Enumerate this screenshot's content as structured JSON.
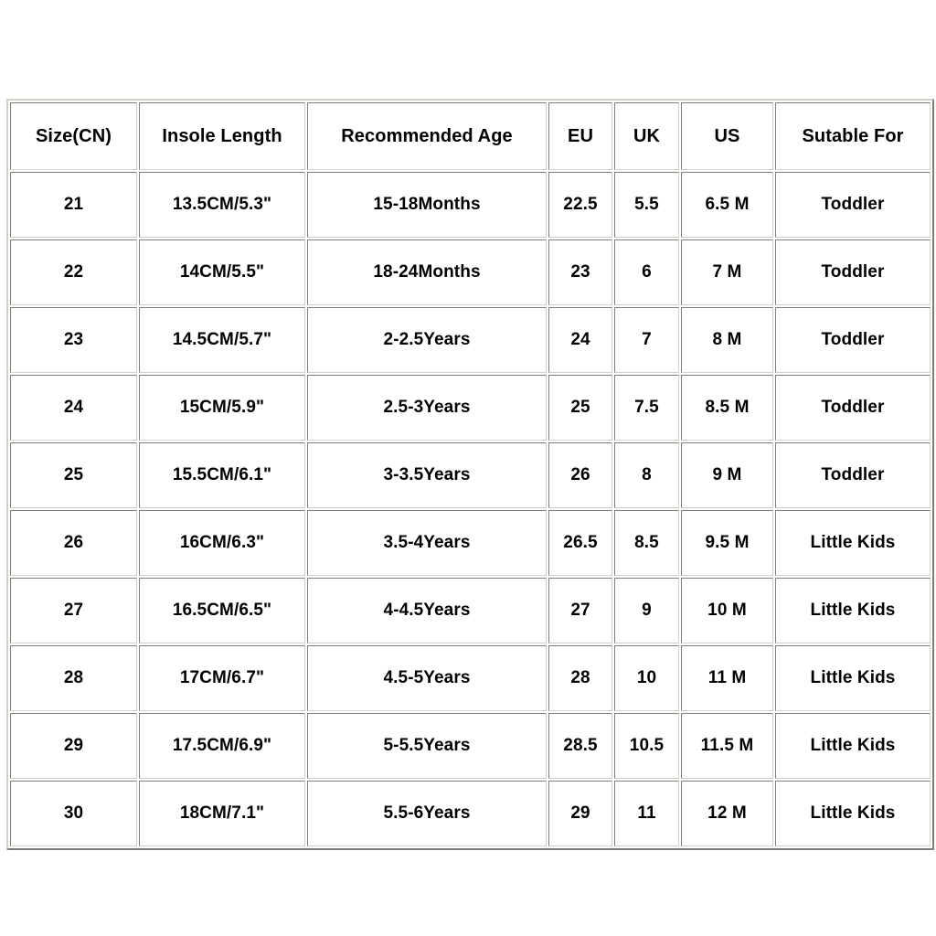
{
  "table": {
    "name": "shoe-size-chart",
    "columns": [
      {
        "key": "size_cn",
        "label": "Size(CN)"
      },
      {
        "key": "insole_length",
        "label": "Insole Length"
      },
      {
        "key": "recommended_age",
        "label": "Recommended Age"
      },
      {
        "key": "eu",
        "label": "EU"
      },
      {
        "key": "uk",
        "label": "UK"
      },
      {
        "key": "us",
        "label": "US"
      },
      {
        "key": "suitable_for",
        "label": "Sutable For"
      }
    ],
    "rows": [
      {
        "size_cn": "21",
        "insole_length": "13.5CM/5.3\"",
        "recommended_age": "15-18Months",
        "eu": "22.5",
        "uk": "5.5",
        "us": "6.5 M",
        "suitable_for": "Toddler"
      },
      {
        "size_cn": "22",
        "insole_length": "14CM/5.5\"",
        "recommended_age": "18-24Months",
        "eu": "23",
        "uk": "6",
        "us": "7 M",
        "suitable_for": "Toddler"
      },
      {
        "size_cn": "23",
        "insole_length": "14.5CM/5.7\"",
        "recommended_age": "2-2.5Years",
        "eu": "24",
        "uk": "7",
        "us": "8 M",
        "suitable_for": "Toddler"
      },
      {
        "size_cn": "24",
        "insole_length": "15CM/5.9\"",
        "recommended_age": "2.5-3Years",
        "eu": "25",
        "uk": "7.5",
        "us": "8.5 M",
        "suitable_for": "Toddler"
      },
      {
        "size_cn": "25",
        "insole_length": "15.5CM/6.1\"",
        "recommended_age": "3-3.5Years",
        "eu": "26",
        "uk": "8",
        "us": "9 M",
        "suitable_for": "Toddler"
      },
      {
        "size_cn": "26",
        "insole_length": "16CM/6.3\"",
        "recommended_age": "3.5-4Years",
        "eu": "26.5",
        "uk": "8.5",
        "us": "9.5 M",
        "suitable_for": "Little Kids"
      },
      {
        "size_cn": "27",
        "insole_length": "16.5CM/6.5\"",
        "recommended_age": "4-4.5Years",
        "eu": "27",
        "uk": "9",
        "us": "10 M",
        "suitable_for": "Little Kids"
      },
      {
        "size_cn": "28",
        "insole_length": "17CM/6.7\"",
        "recommended_age": "4.5-5Years",
        "eu": "28",
        "uk": "10",
        "us": "11 M",
        "suitable_for": "Little Kids"
      },
      {
        "size_cn": "29",
        "insole_length": "17.5CM/6.9\"",
        "recommended_age": "5-5.5Years",
        "eu": "28.5",
        "uk": "10.5",
        "us": "11.5 M",
        "suitable_for": "Little Kids"
      },
      {
        "size_cn": "30",
        "insole_length": "18CM/7.1\"",
        "recommended_age": "5.5-6Years",
        "eu": "29",
        "uk": "11",
        "us": "12 M",
        "suitable_for": "Little Kids"
      }
    ]
  },
  "colors": {
    "page_background": "#ffffff",
    "cell_background": "#ffffff",
    "text": "#000000",
    "border": "#d4d0c8"
  }
}
